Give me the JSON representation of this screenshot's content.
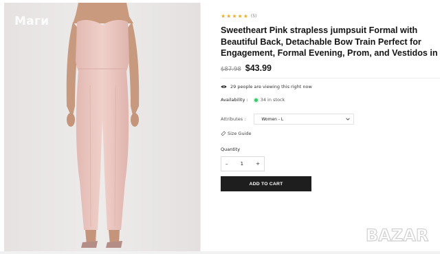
{
  "watermarks": {
    "top_left": "Маги",
    "logo_text": "BAZAR"
  },
  "product": {
    "rating": {
      "stars": 5,
      "count_label": "(5)"
    },
    "title_lines": [
      "Sweetheart Pink strapless jumpsuit Formal with",
      "Beautiful Back, Detachable Bow Train Perfect for",
      "Engagement, Formal Evening, Prom, and Vestidos in"
    ],
    "old_price": "$87.98",
    "new_price": "$43.99",
    "viewers_text": "29 people are viewing this right now",
    "availability": {
      "label": "Availability :",
      "value": "34 in stock",
      "dot_color": "#3cc76a"
    },
    "attributes": {
      "label": "Attributes :",
      "selected": "Women - L"
    },
    "size_guide": "Size Guide",
    "quantity": {
      "label": "Quantity",
      "value": "1",
      "minus": "–",
      "plus": "+"
    },
    "add_to_cart": "ADD TO CART"
  },
  "colors": {
    "star": "#e7b02a",
    "button_bg": "#1e1e1e",
    "jumpsuit": "#edc9c3"
  }
}
